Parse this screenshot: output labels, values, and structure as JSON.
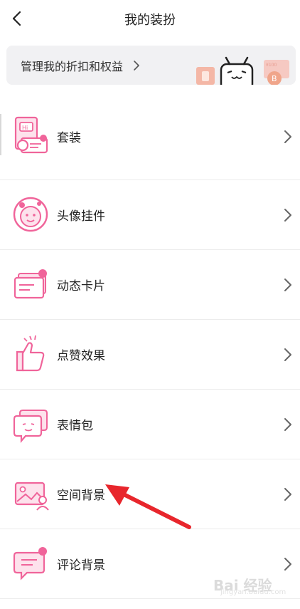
{
  "header": {
    "title": "我的装扮"
  },
  "banner": {
    "text": "管理我的折扣和权益",
    "badge_value": "¥100"
  },
  "menu": {
    "items": [
      {
        "label": "套装",
        "icon": "suit-icon"
      },
      {
        "label": "头像挂件",
        "icon": "avatar-pendant-icon"
      },
      {
        "label": "动态卡片",
        "icon": "dynamic-card-icon"
      },
      {
        "label": "点赞效果",
        "icon": "thumbs-up-icon"
      },
      {
        "label": "表情包",
        "icon": "emoji-pack-icon"
      },
      {
        "label": "空间背景",
        "icon": "space-background-icon"
      },
      {
        "label": "评论背景",
        "icon": "comment-background-icon"
      }
    ]
  },
  "watermark": {
    "brand": "Bai 经验",
    "url": "jingyan.baidu.com"
  },
  "colors": {
    "accent": "#f0649a",
    "accent_light": "#fde2ec",
    "annotation_arrow": "#e8262c"
  }
}
